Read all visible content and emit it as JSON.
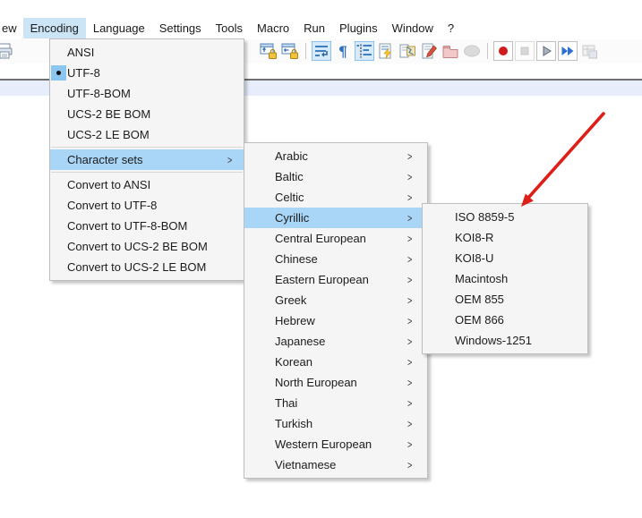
{
  "menu_bar": {
    "items": [
      {
        "label": "ew",
        "note": "partial-view-menu"
      },
      {
        "label": "Encoding",
        "state": "open"
      },
      {
        "label": "Language"
      },
      {
        "label": "Settings"
      },
      {
        "label": "Tools"
      },
      {
        "label": "Macro"
      },
      {
        "label": "Run"
      },
      {
        "label": "Plugins"
      },
      {
        "label": "Window"
      },
      {
        "label": "?"
      }
    ]
  },
  "toolbar": {
    "left_items": [
      {
        "name": "print-icon"
      }
    ],
    "items": [
      {
        "name": "sync-vertical-scrolling-icon"
      },
      {
        "name": "sync-horizontal-scrolling-icon"
      },
      {
        "separator": true
      },
      {
        "name": "word-wrap-icon",
        "state": "active"
      },
      {
        "name": "show-all-characters-icon"
      },
      {
        "name": "show-indent-guide-icon",
        "state": "active"
      },
      {
        "name": "define-language-icon"
      },
      {
        "name": "document-map-icon"
      },
      {
        "name": "function-list-icon"
      },
      {
        "name": "folder-as-workspace-icon"
      },
      {
        "name": "monitoring-icon",
        "state": "disabled"
      },
      {
        "separator": true
      },
      {
        "name": "record-macro-icon",
        "frame": true
      },
      {
        "name": "stop-recording-icon",
        "frame": true,
        "state": "disabled"
      },
      {
        "name": "playback-macro-icon",
        "frame": true
      },
      {
        "name": "run-macro-multiple-times-icon",
        "frame": true
      },
      {
        "name": "save-recorded-macro-icon",
        "state": "disabled"
      }
    ]
  },
  "encoding_menu": {
    "items": [
      {
        "label": "ANSI"
      },
      {
        "label": "UTF-8",
        "checked": true
      },
      {
        "label": "UTF-8-BOM"
      },
      {
        "label": "UCS-2 BE BOM"
      },
      {
        "label": "UCS-2 LE BOM"
      },
      {
        "type": "separator"
      },
      {
        "label": "Character sets",
        "submenu": true,
        "highlighted": true
      },
      {
        "type": "separator"
      },
      {
        "label": "Convert to ANSI"
      },
      {
        "label": "Convert to UTF-8"
      },
      {
        "label": "Convert to UTF-8-BOM"
      },
      {
        "label": "Convert to UCS-2 BE BOM"
      },
      {
        "label": "Convert to UCS-2 LE BOM"
      }
    ]
  },
  "character_sets_menu": {
    "items": [
      {
        "label": "Arabic",
        "submenu": true
      },
      {
        "label": "Baltic",
        "submenu": true
      },
      {
        "label": "Celtic",
        "submenu": true
      },
      {
        "label": "Cyrillic",
        "submenu": true,
        "highlighted": true
      },
      {
        "label": "Central European",
        "submenu": true
      },
      {
        "label": "Chinese",
        "submenu": true
      },
      {
        "label": "Eastern European",
        "submenu": true
      },
      {
        "label": "Greek",
        "submenu": true
      },
      {
        "label": "Hebrew",
        "submenu": true
      },
      {
        "label": "Japanese",
        "submenu": true
      },
      {
        "label": "Korean",
        "submenu": true
      },
      {
        "label": "North European",
        "submenu": true
      },
      {
        "label": "Thai",
        "submenu": true
      },
      {
        "label": "Turkish",
        "submenu": true
      },
      {
        "label": "Western European",
        "submenu": true
      },
      {
        "label": "Vietnamese",
        "submenu": true
      }
    ]
  },
  "cyrillic_menu": {
    "items": [
      {
        "label": "ISO 8859-5"
      },
      {
        "label": "KOI8-R"
      },
      {
        "label": "KOI8-U"
      },
      {
        "label": "Macintosh"
      },
      {
        "label": "OEM 855"
      },
      {
        "label": "OEM 866"
      },
      {
        "label": "Windows-1251"
      }
    ]
  },
  "annotation": {
    "type": "red-arrow",
    "points_to": "ISO 8859-5",
    "color": "#de1f18"
  },
  "colors": {
    "menubar_highlight": "#cbe4f6",
    "menu_highlight": "#a9d5f7",
    "check_background": "#8ac6f0",
    "panel_background": "#f5f5f5",
    "panel_border": "#bdbdbd",
    "tab_band": "#e8edfb",
    "annotation_arrow": "#de1f18"
  }
}
